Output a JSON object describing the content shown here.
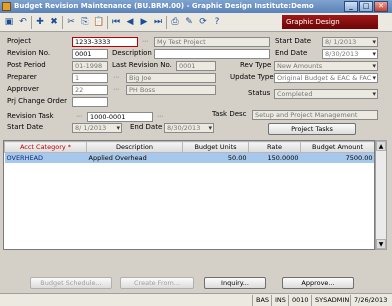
{
  "window": {
    "title": "Budget Revision Maintenance (BU.BRM.00) - Graphic Design Institute:Demo",
    "min": "_",
    "max": "□",
    "close": "✕"
  },
  "toolbar": {
    "company": "Graphic Design",
    "icons": [
      "save-icon",
      "undo-icon",
      "insert-icon",
      "delete-icon",
      "cut-icon",
      "copy-icon",
      "paste-icon",
      "first-icon",
      "prev-icon",
      "next-icon",
      "last-icon",
      "print-icon",
      "note-icon",
      "refresh-icon",
      "help-icon"
    ]
  },
  "form": {
    "project_label": "Project",
    "project_value": "1233-3333",
    "project_desc": "My Test Project",
    "start_date_label": "Start Date",
    "start_date": "8/ 1/2013",
    "revision_no_label": "Revision No.",
    "revision_no": "0001",
    "description_label": "Description",
    "description": "",
    "end_date_label": "End Date",
    "end_date": "8/30/2013",
    "post_period_label": "Post Period",
    "post_period": "01-1998",
    "last_revision_label": "Last Revision No.",
    "last_revision": "0001",
    "rev_type_label": "Rev Type",
    "rev_type": "New Amounts",
    "preparer_label": "Preparer",
    "preparer_id": "1",
    "preparer_name": "Big Joe",
    "update_type_label": "Update Type",
    "update_type": "Original Budget & EAC & FAC",
    "approver_label": "Approver",
    "approver_id": "22",
    "approver_name": "PH Boss",
    "status_label": "Status",
    "status": "Completed",
    "prj_change_order_label": "Prj Change Order",
    "prj_change_order": ""
  },
  "task": {
    "revision_task_label": "Revision Task",
    "revision_task": "1000-0001",
    "task_desc_label": "Task Desc",
    "task_desc": "Setup and Project Management",
    "start_date_label": "Start Date",
    "start_date": "8/ 1/2013",
    "end_date_label": "End Date",
    "end_date": "8/30/2013",
    "project_tasks_button": "Project Tasks"
  },
  "grid": {
    "columns": [
      "Acct Category *",
      "Description",
      "Budget Units",
      "Rate",
      "Budget Amount"
    ],
    "rows": [
      [
        "OVERHEAD",
        "Applied Overhead",
        "50.00",
        "150.0000",
        "7500.00"
      ]
    ]
  },
  "buttons": {
    "budget_schedule": "Budget Schedule...",
    "create_from": "Create From...",
    "inquiry": "Inquiry...",
    "approve": "Approve..."
  },
  "statusbar": {
    "module": "BAS",
    "mode": "INS",
    "company_id": "0010",
    "user": "SYSADMIN",
    "date": "7/26/2013"
  }
}
